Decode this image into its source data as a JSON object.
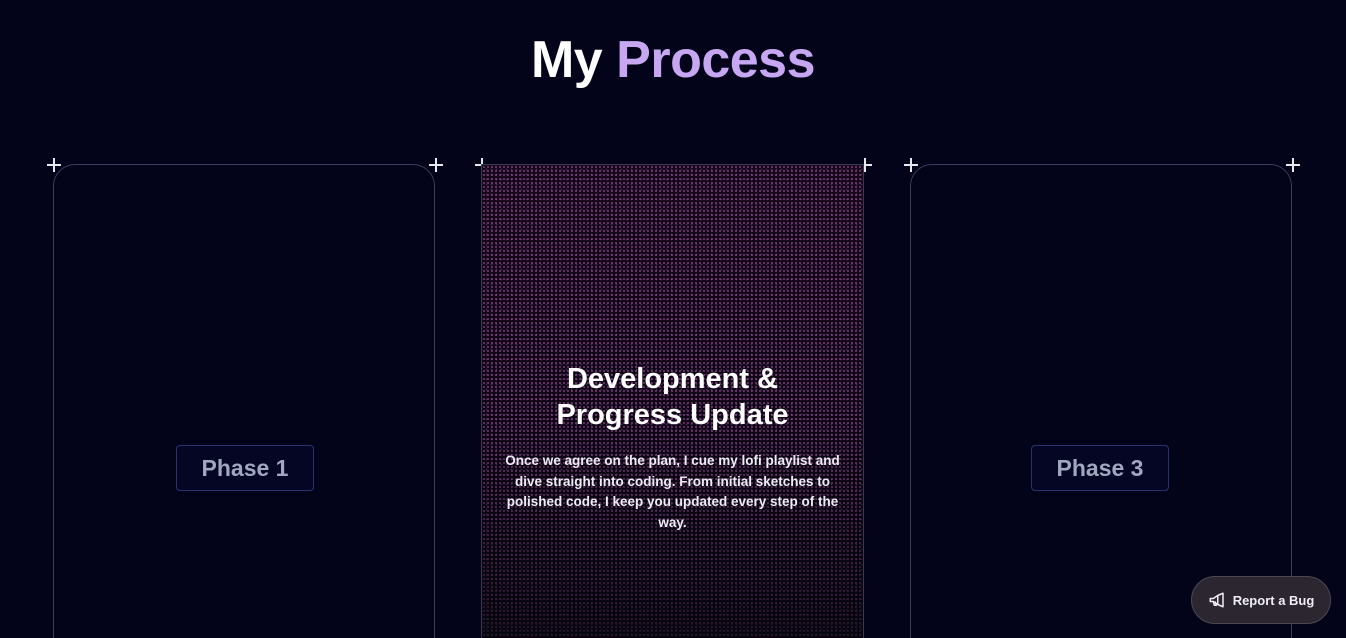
{
  "heading": {
    "word1": "My",
    "word2": "Process"
  },
  "phases": [
    {
      "label": "Phase 1"
    },
    {
      "title": "Development & Progress Update",
      "description": "Once we agree on the plan, I cue my lofi playlist and dive straight into coding. From initial sketches to polished code, I keep you updated every step of the way."
    },
    {
      "label": "Phase 3"
    }
  ],
  "report_bug": {
    "label": "Report a Bug",
    "icon": "megaphone-icon"
  },
  "colors": {
    "background": "#03031a",
    "accent": "#c7a6f2",
    "badge_border": "#2a3170"
  }
}
